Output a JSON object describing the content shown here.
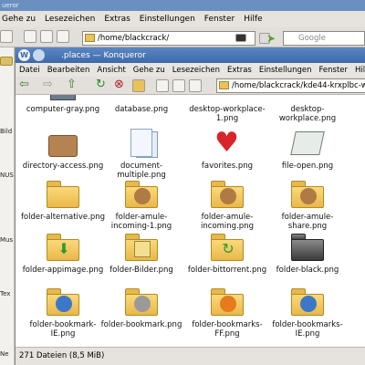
{
  "bg_window": {
    "title": "ueror",
    "menu": [
      "Gehe zu",
      "Lesezeichen",
      "Extras",
      "Einstellungen",
      "Fenster",
      "Hilfe"
    ],
    "address": "/home/blackcrack/",
    "search_placeholder": "Google",
    "side_labels": [
      "Bild",
      "NUS",
      "Mus",
      "Tex",
      "Ne"
    ]
  },
  "fg_window": {
    "title": ".places — Konqueror",
    "menu": [
      "Datei",
      "Bearbeiten",
      "Ansicht",
      "Gehe zu",
      "Lesezeichen",
      "Extras",
      "Einstellungen",
      "Fenster",
      "Hilfe"
    ],
    "address": "/home/blackcrack/kde44-krxplbc-w",
    "status": "271 Dateien (8,5 MiB)"
  },
  "files": {
    "row0": [
      "computer-gray.png",
      "database.png",
      "desktop-workplace-1.png",
      "desktop-workplace.png"
    ],
    "row1": [
      "directory-access.png",
      "document-multiple.png",
      "favorites.png",
      "file-open.png"
    ],
    "row2": [
      "folder-alternative.png",
      "folder-amule-incoming-1.png",
      "folder-amule-incoming.png",
      "folder-amule-share.png"
    ],
    "row3": [
      "folder-appimage.png",
      "folder-Bilder.png",
      "folder-bittorrent.png",
      "folder-black.png"
    ],
    "row4": [
      "folder-bookmark-IE.png",
      "folder-bookmark.png",
      "folder-bookmarks-FF.png",
      "folder-bookmarks-IE.png"
    ]
  },
  "colors": {
    "folder": "#f0c45a",
    "titlebar": "#4a76b5",
    "heart": "#d8252b"
  }
}
